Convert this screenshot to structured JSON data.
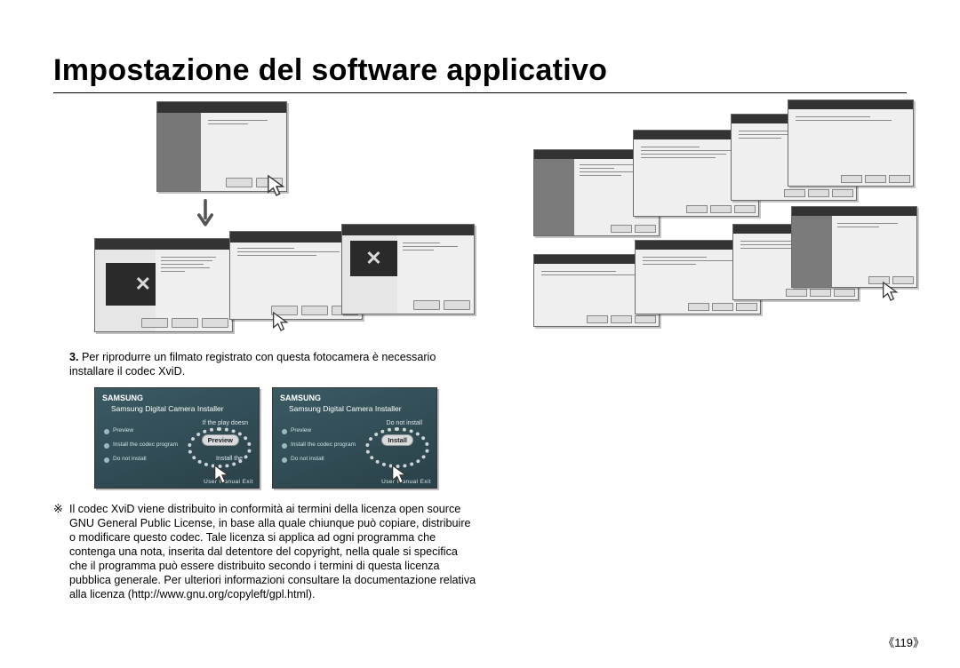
{
  "title": "Impostazione del software applicativo",
  "step": {
    "num": "3.",
    "text": "Per riprodurre un filmato registrato con questa fotocamera è necessario installare il codec XviD."
  },
  "note_marker": "※",
  "note": "Il codec XviD viene distribuito in conformità ai termini della licenza open source GNU General Public License, in base alla quale chiunque può copiare, distribuire o modificare questo codec. Tale licenza si applica ad ogni programma che contenga una nota, inserita dal detentore del copyright, nella quale si specifica che il programma può essere distribuito secondo i termini di questa licenza pubblica generale. Per ulteriori informazioni consultare la documentazione relativa alla licenza (http://www.gnu.org/copyleft/gpl.html).",
  "page_number": "《119》",
  "installer_card": {
    "brand": "SAMSUNG",
    "header": "Samsung Digital Camera Installer",
    "options": {
      "preview": "Preview",
      "install_codec": "Install the codec program",
      "do_not_install": "Do not install",
      "install": "Install"
    },
    "pill_left": "Preview",
    "pill_right": "Install",
    "tag_left": "Install the",
    "tag_right": "Do not install",
    "tag_above_left": "If the play doesn",
    "footer": "User Manual    Exit"
  },
  "icons": {
    "arrow_down": "arrow-down-icon",
    "cursor": "cursor-icon"
  }
}
